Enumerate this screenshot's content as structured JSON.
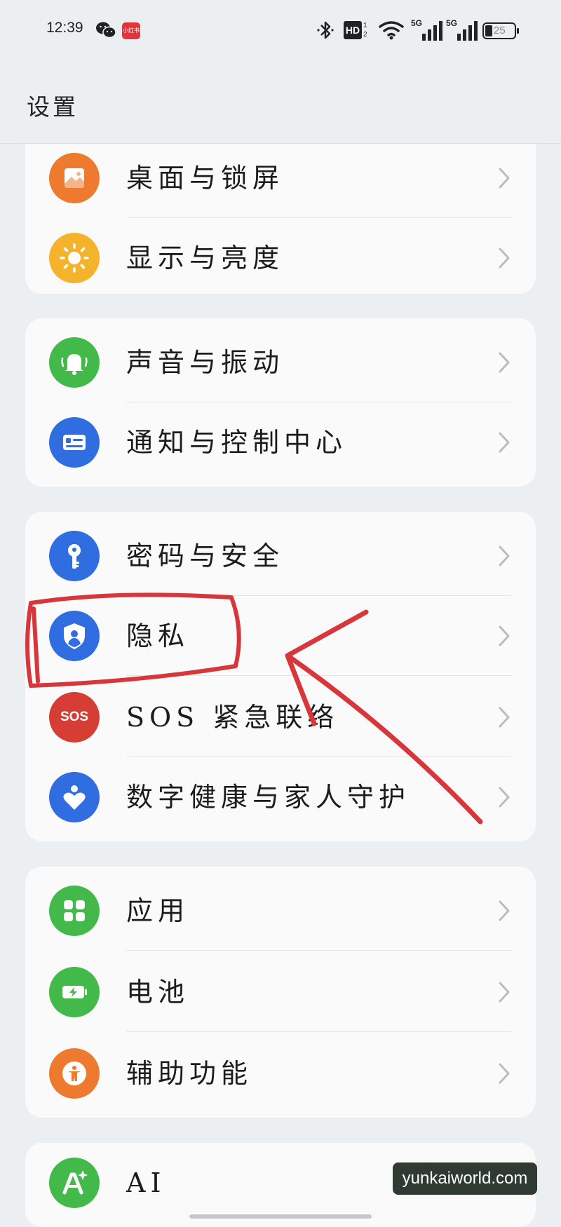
{
  "status_bar": {
    "time": "12:39",
    "xhs_badge": "小红书",
    "hd_label": "HD",
    "hd_sub": "1 2",
    "net1": "5G",
    "net2": "5G",
    "battery": "25"
  },
  "header": {
    "title": "设置"
  },
  "groups": [
    {
      "items": [
        {
          "label": "桌面与锁屏",
          "icon": "wallpaper-icon",
          "color": "#ee7a2f"
        },
        {
          "label": "显示与亮度",
          "icon": "sun-icon",
          "color": "#f4b32b"
        }
      ]
    },
    {
      "items": [
        {
          "label": "声音与振动",
          "icon": "bell-icon",
          "color": "#43b94a"
        },
        {
          "label": "通知与控制中心",
          "icon": "notification-icon",
          "color": "#2f6de0"
        }
      ]
    },
    {
      "items": [
        {
          "label": "密码与安全",
          "icon": "key-icon",
          "color": "#2f6de0"
        },
        {
          "label": "隐私",
          "icon": "privacy-shield-icon",
          "color": "#2f6de0"
        },
        {
          "label": "SOS 紧急联络",
          "icon": "sos-icon",
          "icon_text": "SOS",
          "color": "#d63d35"
        },
        {
          "label": "数字健康与家人守护",
          "icon": "heart-icon",
          "color": "#2f6de0"
        }
      ]
    },
    {
      "items": [
        {
          "label": "应用",
          "icon": "apps-icon",
          "color": "#43b94a"
        },
        {
          "label": "电池",
          "icon": "battery-icon",
          "color": "#43b94a"
        },
        {
          "label": "辅助功能",
          "icon": "accessibility-icon",
          "color": "#ee7a2f"
        }
      ]
    },
    {
      "items": [
        {
          "label": "AI",
          "icon": "ai-icon",
          "color": "#43b94a"
        }
      ]
    }
  ],
  "watermark": "yunkaiworld.com",
  "annotation_color": "#d7363a"
}
